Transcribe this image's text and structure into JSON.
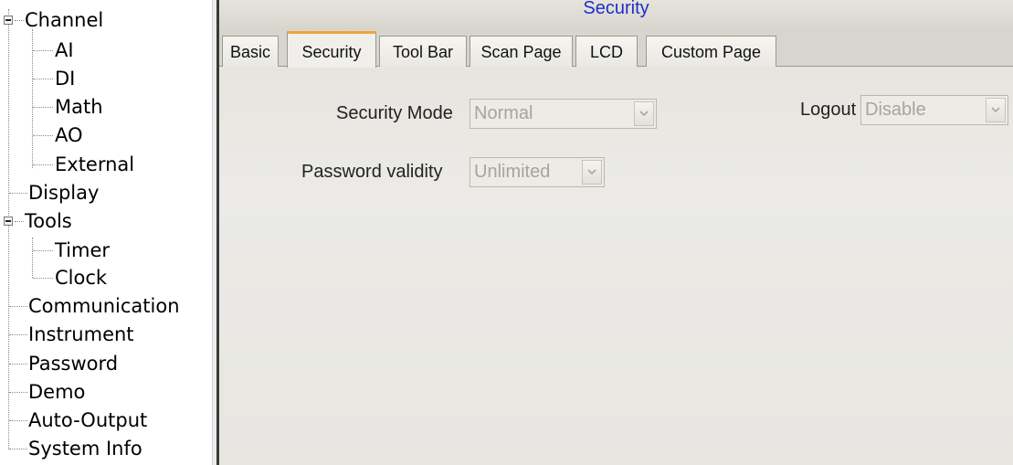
{
  "tree": {
    "items": [
      {
        "label": "Channel",
        "expandable": true
      },
      {
        "label": "AI"
      },
      {
        "label": "DI"
      },
      {
        "label": "Math"
      },
      {
        "label": "AO"
      },
      {
        "label": "External"
      },
      {
        "label": "Display"
      },
      {
        "label": "Tools",
        "expandable": true
      },
      {
        "label": "Timer"
      },
      {
        "label": "Clock"
      },
      {
        "label": "Communication"
      },
      {
        "label": "Instrument"
      },
      {
        "label": "Password"
      },
      {
        "label": "Demo"
      },
      {
        "label": "Auto-Output"
      },
      {
        "label": "System Info"
      }
    ]
  },
  "header": {
    "title": "Security"
  },
  "tabs": [
    {
      "label": "Basic"
    },
    {
      "label": "Security",
      "active": true
    },
    {
      "label": "Tool Bar"
    },
    {
      "label": "Scan Page"
    },
    {
      "label": "LCD"
    },
    {
      "label": "Custom Page"
    }
  ],
  "form": {
    "security_mode": {
      "label": "Security Mode",
      "value": "Normal"
    },
    "password_validity": {
      "label": "Password validity",
      "value": "Unlimited"
    },
    "logout": {
      "label": "Logout",
      "value": "Disable"
    }
  },
  "colors": {
    "title": "#1f2fc8",
    "active_tab_accent": "#f2a53a",
    "disabled_text": "#a6a49c"
  },
  "icons": {
    "expander": "collapse-minus-icon",
    "dropdown": "chevron-down-icon"
  }
}
